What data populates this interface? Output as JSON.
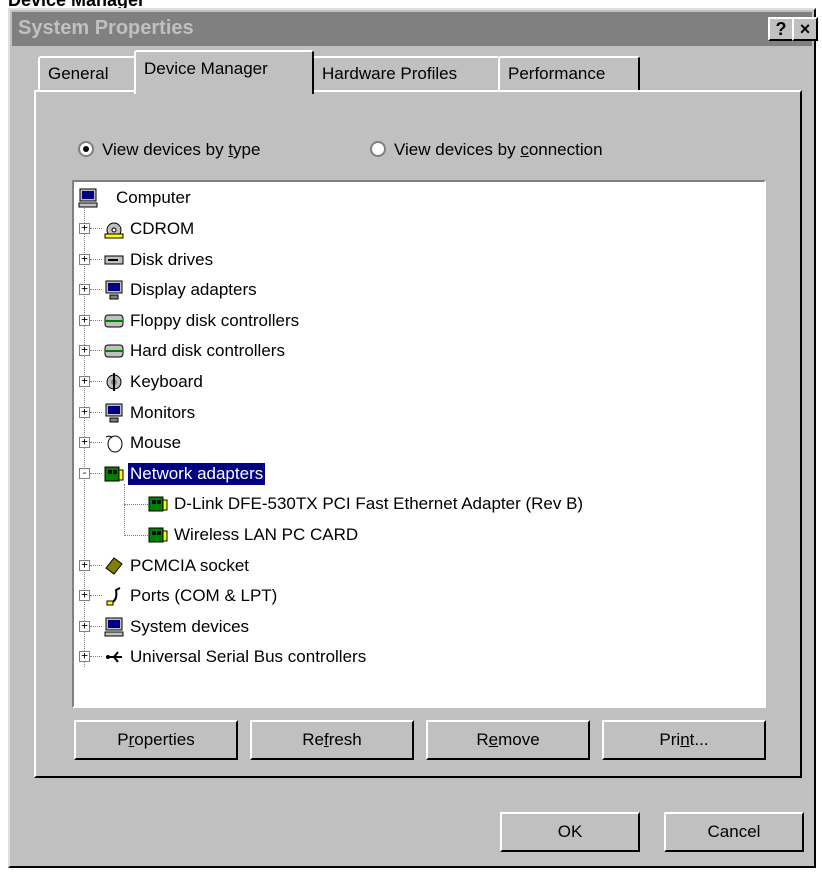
{
  "top_caption": "Device Manager",
  "window": {
    "title": "System Properties",
    "help_button": "?",
    "close_button": "×"
  },
  "tabs": [
    {
      "label": "General"
    },
    {
      "label": "Device Manager"
    },
    {
      "label": "Hardware Profiles"
    },
    {
      "label": "Performance"
    }
  ],
  "view_options": {
    "by_type": {
      "pre": "View devices by ",
      "u": "t",
      "post": "ype",
      "selected": true
    },
    "by_connection": {
      "pre": "View devices by ",
      "u": "c",
      "post": "onnection",
      "selected": false
    }
  },
  "tree": {
    "root": "Computer",
    "items": [
      {
        "label": "CDROM",
        "icon": "cdrom-icon"
      },
      {
        "label": "Disk drives",
        "icon": "disk-drive-icon"
      },
      {
        "label": "Display adapters",
        "icon": "display-adapter-icon"
      },
      {
        "label": "Floppy disk controllers",
        "icon": "floppy-controller-icon"
      },
      {
        "label": "Hard disk controllers",
        "icon": "hard-disk-controller-icon"
      },
      {
        "label": "Keyboard",
        "icon": "keyboard-icon"
      },
      {
        "label": "Monitors",
        "icon": "monitor-icon"
      },
      {
        "label": "Mouse",
        "icon": "mouse-icon"
      },
      {
        "label": "Network adapters",
        "icon": "network-adapter-icon",
        "expanded": true,
        "selected": true,
        "children": [
          {
            "label": "D-Link DFE-530TX PCI Fast Ethernet Adapter (Rev B)",
            "icon": "network-card-icon"
          },
          {
            "label": "Wireless LAN PC CARD",
            "icon": "network-card-icon"
          }
        ]
      },
      {
        "label": "PCMCIA socket",
        "icon": "pcmcia-icon"
      },
      {
        "label": "Ports (COM & LPT)",
        "icon": "port-icon"
      },
      {
        "label": "System devices",
        "icon": "system-device-icon"
      },
      {
        "label": "Universal Serial Bus controllers",
        "icon": "usb-icon"
      }
    ]
  },
  "action_buttons": {
    "properties": {
      "pre": "P",
      "u": "r",
      "post": "operties"
    },
    "refresh": {
      "pre": "Re",
      "u": "f",
      "post": "resh"
    },
    "remove": {
      "pre": "R",
      "u": "e",
      "post": "move"
    },
    "print": {
      "pre": "Pri",
      "u": "n",
      "post": "t..."
    }
  },
  "dialog_buttons": {
    "ok": "OK",
    "cancel": "Cancel"
  },
  "colors": {
    "face": "#c0c0c0",
    "selection": "#000080",
    "title_inactive": "#808080"
  }
}
